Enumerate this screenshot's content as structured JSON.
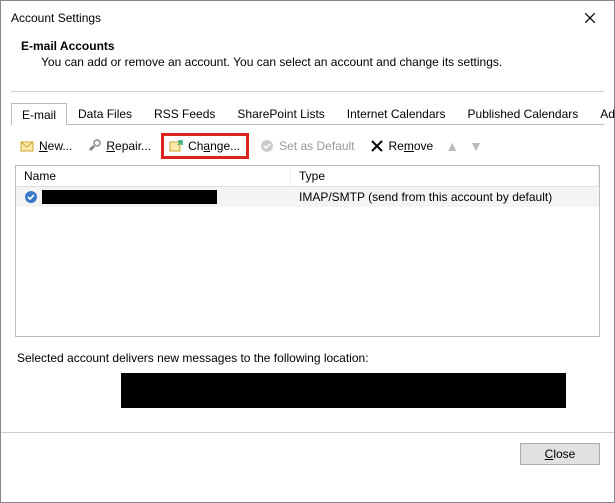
{
  "title": "Account Settings",
  "header": {
    "title": "E-mail Accounts",
    "desc": "You can add or remove an account. You can select an account and change its settings."
  },
  "tabs": {
    "items": [
      {
        "label": "E-mail",
        "active": true
      },
      {
        "label": "Data Files"
      },
      {
        "label": "RSS Feeds"
      },
      {
        "label": "SharePoint Lists"
      },
      {
        "label": "Internet Calendars"
      },
      {
        "label": "Published Calendars"
      },
      {
        "label": "Address Books"
      }
    ]
  },
  "toolbar": {
    "new": "New...",
    "repair": "Repair...",
    "change": "Change...",
    "set_default": "Set as Default",
    "remove": "Remove"
  },
  "table": {
    "col_name": "Name",
    "col_type": "Type",
    "rows": [
      {
        "name": "",
        "type": "IMAP/SMTP (send from this account by default)"
      }
    ]
  },
  "location_text": "Selected account delivers new messages to the following location:",
  "close_label": "Close"
}
